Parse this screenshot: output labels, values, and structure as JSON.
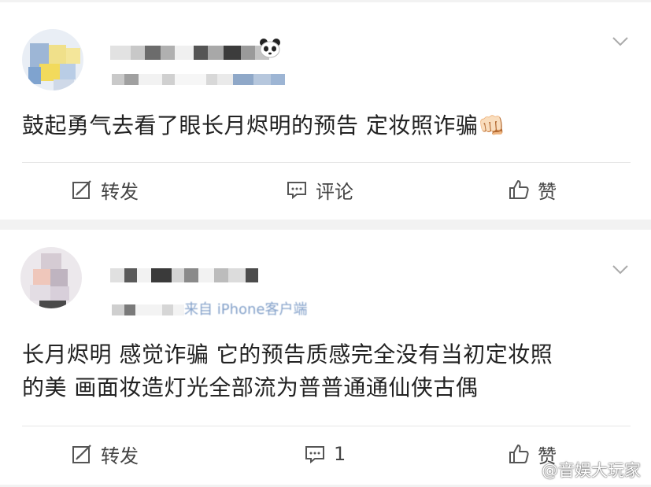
{
  "posts": [
    {
      "text": "鼓起勇气去看了眼长月烬明的预告 定妆照诈骗",
      "emoji": "👊🏻",
      "actions": {
        "repost": "转发",
        "comment": "评论",
        "like": "赞"
      }
    },
    {
      "meta_source": "来自 iPhone客户端",
      "text_line1": "长月烬明 感觉诈骗 它的预告质感完全没有当初定妆照",
      "text_line2": "的美 画面妆造灯光全部流为普普通通仙侠古偶",
      "actions": {
        "repost": "转发",
        "comment_count": "1",
        "like": "赞"
      }
    }
  ],
  "watermark": "@音娱大玩家",
  "icons": [
    "repost-icon",
    "comment-icon",
    "like-icon",
    "chevron-down-icon",
    "panda-badge-icon",
    "weibo-logo-icon"
  ],
  "colors": {
    "text": "#222222",
    "action_text": "#444444",
    "background": "#f2f2f2",
    "card": "#ffffff"
  }
}
